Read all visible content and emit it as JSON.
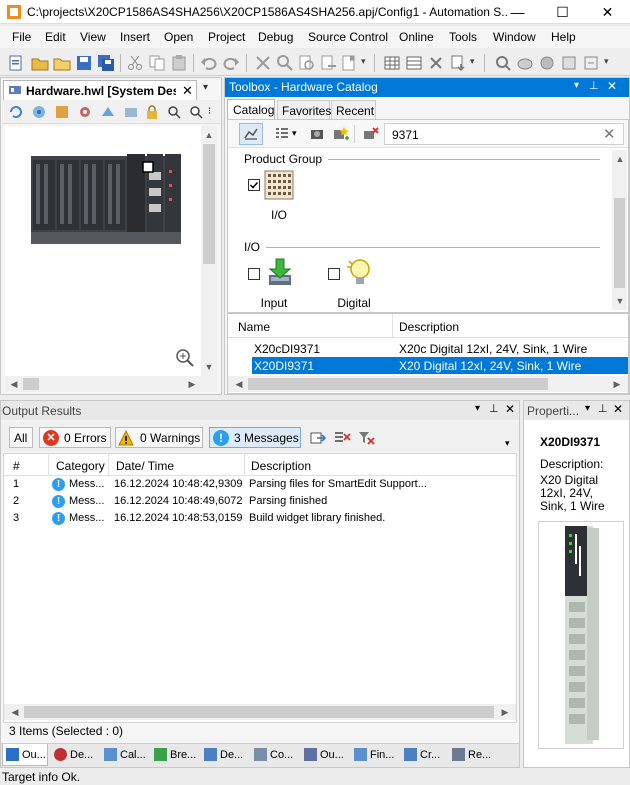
{
  "window": {
    "title": "C:\\projects\\X20CP1586AS4SHA256\\X20CP1586AS4SHA256.apj/Config1 - Automation S...",
    "minimize": "—",
    "maximize": "☐",
    "close": "✕"
  },
  "menu": [
    "File",
    "Edit",
    "View",
    "Insert",
    "Open",
    "Project",
    "Debug",
    "Source Control",
    "Online",
    "Tools",
    "Window",
    "Help"
  ],
  "hardware_panel": {
    "title": "Hardware.hwl [System Desi...",
    "close": "✕"
  },
  "toolbox": {
    "title": "Toolbox - Hardware Catalog",
    "tabs": [
      "Catalog",
      "Favorites",
      "Recent"
    ],
    "search_value": "9371",
    "groups": [
      {
        "title": "Product Group",
        "items": [
          {
            "label": "I/O",
            "checked": true
          }
        ]
      },
      {
        "title": "I/O",
        "items": [
          {
            "label": "Input",
            "checked": false
          },
          {
            "label": "Digital",
            "checked": false
          }
        ]
      }
    ],
    "columns": [
      "Name",
      "Description"
    ],
    "rows": [
      {
        "name": "X20cDI9371",
        "description": "X20c Digital 12xI, 24V, Sink, 1 Wire",
        "selected": false
      },
      {
        "name": "X20DI9371",
        "description": "X20 Digital 12xI, 24V, Sink, 1 Wire",
        "selected": true
      }
    ]
  },
  "output": {
    "title": "Output Results",
    "filters": {
      "all": "All",
      "errors": "0 Errors",
      "warnings": "0 Warnings",
      "messages": "3 Messages"
    },
    "columns": [
      "#",
      "Category",
      "Date/ Time",
      "Description"
    ],
    "rows": [
      {
        "num": "1",
        "category": "Mess...",
        "datetime": "16.12.2024 10:48:42,9309",
        "description": "Parsing files for SmartEdit Support..."
      },
      {
        "num": "2",
        "category": "Mess...",
        "datetime": "16.12.2024 10:48:49,6072",
        "description": "Parsing finished"
      },
      {
        "num": "3",
        "category": "Mess...",
        "datetime": "16.12.2024 10:48:53,0159",
        "description": "Build widget library finished."
      }
    ],
    "footer": "3 Items (Selected : 0)"
  },
  "properties": {
    "title": "Properti...",
    "name": "X20DI9371",
    "description_label": "Description:",
    "description_value": "X20 Digital 12xI, 24V, Sink, 1 Wire"
  },
  "bottom_tabs": [
    "Ou...",
    "De...",
    "Cal...",
    "Bre...",
    "De...",
    "Co...",
    "Ou...",
    "Fin...",
    "Cr...",
    "Re..."
  ],
  "status": "Target info Ok.",
  "colors": {
    "accent": "#0078d7",
    "selection": "#0078d7",
    "group_title": "#1e4fa3"
  }
}
